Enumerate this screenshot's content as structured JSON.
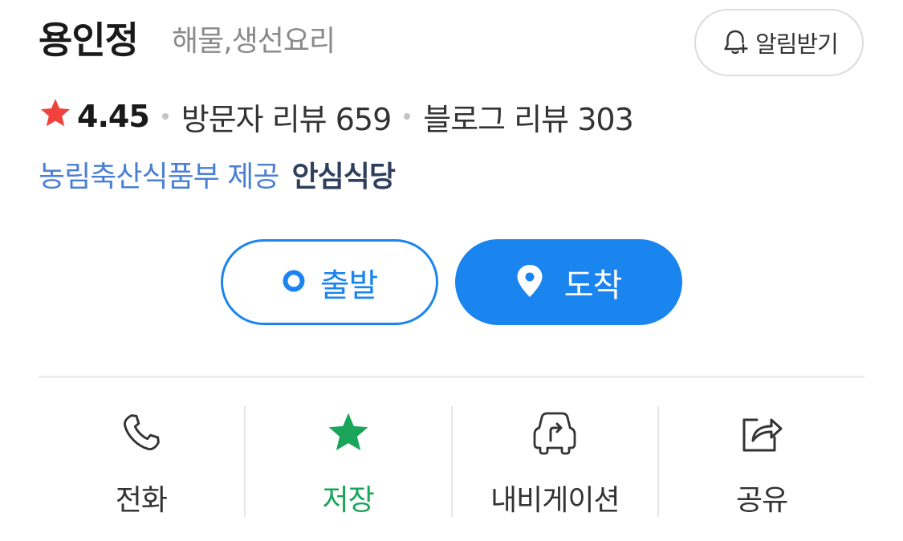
{
  "header": {
    "place_name": "용인정",
    "category": "해물,생선요리",
    "alert_button_label": "알림받기"
  },
  "rating": {
    "star_icon": "star-icon",
    "score": "4.45",
    "visitor_reviews": "방문자 리뷰 659",
    "blog_reviews": "블로그 리뷰 303"
  },
  "certification": {
    "provider": "농림축산식품부 제공",
    "name": "안심식당"
  },
  "directions": {
    "departure_label": "출발",
    "arrival_label": "도착"
  },
  "actions": [
    {
      "label": "전화",
      "icon": "phone-icon",
      "active": false
    },
    {
      "label": "저장",
      "icon": "star-icon",
      "active": true
    },
    {
      "label": "내비게이션",
      "icon": "navigation-car-icon",
      "active": false
    },
    {
      "label": "공유",
      "icon": "share-icon",
      "active": false
    }
  ],
  "colors": {
    "primary_blue": "#1a84ef",
    "rating_star": "#f0423c",
    "saved_green": "#1aa55a",
    "cert_provider": "#4a7fd4",
    "cert_name": "#2f3e5c"
  }
}
